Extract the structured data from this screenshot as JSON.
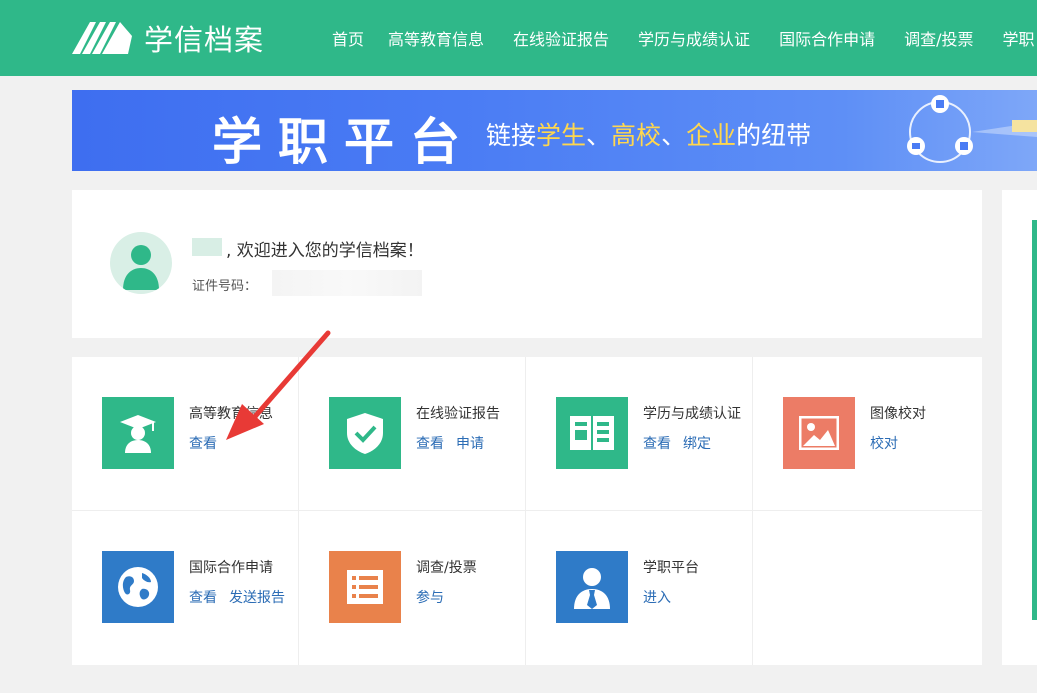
{
  "header": {
    "logo_text": "学信档案",
    "nav": [
      "首页",
      "高等教育信息",
      "在线验证报告",
      "学历与成绩认证",
      "国际合作申请",
      "调查/投票",
      "学职"
    ]
  },
  "banner": {
    "title": "学职平台",
    "sub_prefix": "链接",
    "sub_student": "学生",
    "sub_sep1": "、",
    "sub_school": "高校",
    "sub_sep2": "、",
    "sub_company": "企业",
    "sub_suffix": "的纽带"
  },
  "profile": {
    "welcome": ", 欢迎进入您的学信档案！",
    "id_label": "证件号码："
  },
  "services": [
    {
      "title": "高等教育信息",
      "icon": "graduate-icon",
      "color": "#2fb889",
      "links": [
        "查看"
      ]
    },
    {
      "title": "在线验证报告",
      "icon": "shield-check-icon",
      "color": "#2fb889",
      "links": [
        "查看",
        "申请"
      ]
    },
    {
      "title": "学历与成绩认证",
      "icon": "book-icon",
      "color": "#2fb889",
      "links": [
        "查看",
        "绑定"
      ]
    },
    {
      "title": "图像校对",
      "icon": "image-icon",
      "color": "#ec7c66",
      "links": [
        "校对"
      ]
    },
    {
      "title": "国际合作申请",
      "icon": "globe-icon",
      "color": "#2f7bc8",
      "links": [
        "查看",
        "发送报告"
      ]
    },
    {
      "title": "调查/投票",
      "icon": "list-icon",
      "color": "#e9824b",
      "links": [
        "参与"
      ]
    },
    {
      "title": "学职平台",
      "icon": "person-tie-icon",
      "color": "#2f7bc8",
      "links": [
        "进入"
      ]
    }
  ]
}
